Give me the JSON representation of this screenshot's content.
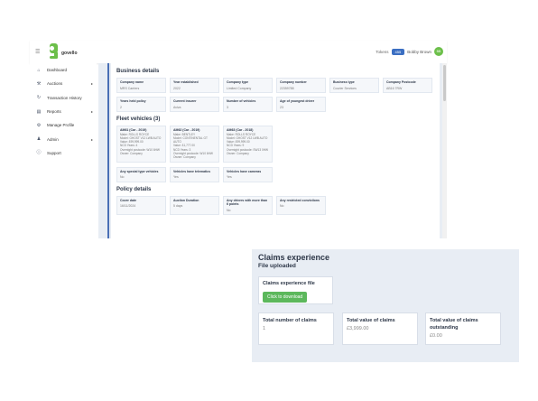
{
  "header": {
    "logo_text": "govello",
    "tokens_label": "Tokens",
    "tokens_value": "455",
    "user_name": "Bobby Brown",
    "user_initials": "BB"
  },
  "sidebar": {
    "items": [
      {
        "label": "Dashboard",
        "icon": "home-icon"
      },
      {
        "label": "Auctions",
        "icon": "gavel-icon",
        "expandable": true
      },
      {
        "label": "Transaction History",
        "icon": "history-icon"
      },
      {
        "label": "Reports",
        "icon": "reports-icon",
        "expandable": true
      },
      {
        "label": "Manage Profile",
        "icon": "gear-icon"
      },
      {
        "label": "Admin",
        "icon": "users-icon",
        "expandable": true
      },
      {
        "label": "Support",
        "icon": "info-icon"
      }
    ]
  },
  "business": {
    "title": "Business details",
    "fields": [
      {
        "label": "Company name",
        "value": "MRS Carriers"
      },
      {
        "label": "Year established",
        "value": "2022"
      },
      {
        "label": "Company type",
        "value": "Limited Company"
      },
      {
        "label": "Company number",
        "value": "22359788"
      },
      {
        "label": "Business type",
        "value": "Courier Services"
      },
      {
        "label": "Company Postcode",
        "value": "AB16 7RW"
      },
      {
        "label": "Years held policy",
        "value": "2"
      },
      {
        "label": "Current insurer",
        "value": "Aviva"
      },
      {
        "label": "Number of vehicles",
        "value": "3"
      },
      {
        "label": "Age of youngest driver",
        "value": "23"
      }
    ]
  },
  "fleet": {
    "title": "Fleet vehicles (3)",
    "vehicles": [
      {
        "title": "AM61 (Car - 2019)",
        "rows": [
          "Make: ROLLS ROYCE",
          "Model: GHOST V12 LWB AUTO",
          "Value: £99,999.00",
          "NCD Years: 4",
          "Overnight postcode: W10 6HW",
          "Owner: Company"
        ]
      },
      {
        "title": "AM62 (Car - 2019)",
        "rows": [
          "Make: BENTLEY",
          "Model: CONTINENTAL GT AUTO",
          "Value: £1,777.00",
          "NCD Years: 3",
          "Overnight postcode: W10 6HW",
          "Owner: Company"
        ]
      },
      {
        "title": "AM63 (Car - 2018)",
        "rows": [
          "Make: ROLLS ROYCE",
          "Model: GHOST V12 LWB AUTO",
          "Value: £99,999.00",
          "NCD Years: 9",
          "Overnight postcode: SW13 0HW",
          "Owner: Company"
        ]
      }
    ],
    "extras": [
      {
        "label": "Any special type vehicles",
        "value": "No"
      },
      {
        "label": "Vehicles have telematics",
        "value": "Yes"
      },
      {
        "label": "Vehicles have cameras",
        "value": "Yes"
      }
    ]
  },
  "policy": {
    "title": "Policy details",
    "fields": [
      {
        "label": "Cover date",
        "value": "16/11/2024"
      },
      {
        "label": "Auction Duration",
        "value": "5 days"
      },
      {
        "label": "Any drivers with more than 6 points",
        "value": "No"
      },
      {
        "label": "Any restricted convictions",
        "value": "No"
      }
    ]
  },
  "claims": {
    "title": "Claims experience",
    "subtitle": "File uploaded",
    "file_label": "Claims experience file",
    "download_label": "Click to download",
    "stats": [
      {
        "label": "Total number of claims",
        "value": "1"
      },
      {
        "label": "Total value of claims",
        "value": "£3,999.00"
      },
      {
        "label": "Total value of claims outstanding",
        "value": "£0.00"
      }
    ]
  },
  "colors": {
    "brand_green": "#6cbf4a",
    "accent_blue": "#3b6fc2",
    "button_green": "#5cb85c",
    "panel_bg": "#e8edf4"
  }
}
